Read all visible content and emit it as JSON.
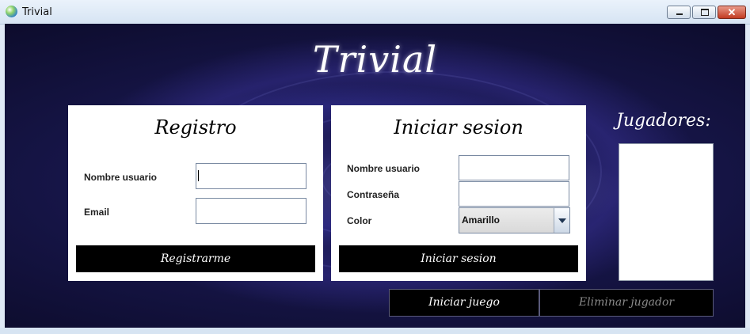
{
  "window": {
    "title": "Trivial"
  },
  "app": {
    "title": "Trivial"
  },
  "registro": {
    "title": "Registro",
    "username_label": "Nombre usuario",
    "username_value": "",
    "email_label": "Email",
    "email_value": "",
    "submit_label": "Registrarme"
  },
  "login": {
    "title": "Iniciar sesion",
    "username_label": "Nombre usuario",
    "username_value": "",
    "password_label": "Contraseña",
    "password_value": "",
    "color_label": "Color",
    "color_selected": "Amarillo",
    "submit_label": "Iniciar sesion"
  },
  "players": {
    "title": "Jugadores:",
    "items": []
  },
  "actions": {
    "start_label": "Iniciar juego",
    "remove_label": "Eliminar jugador"
  },
  "colors": {
    "button_bg": "#000000",
    "text_light": "#ffffff",
    "disabled_text": "#8a8a8a"
  }
}
